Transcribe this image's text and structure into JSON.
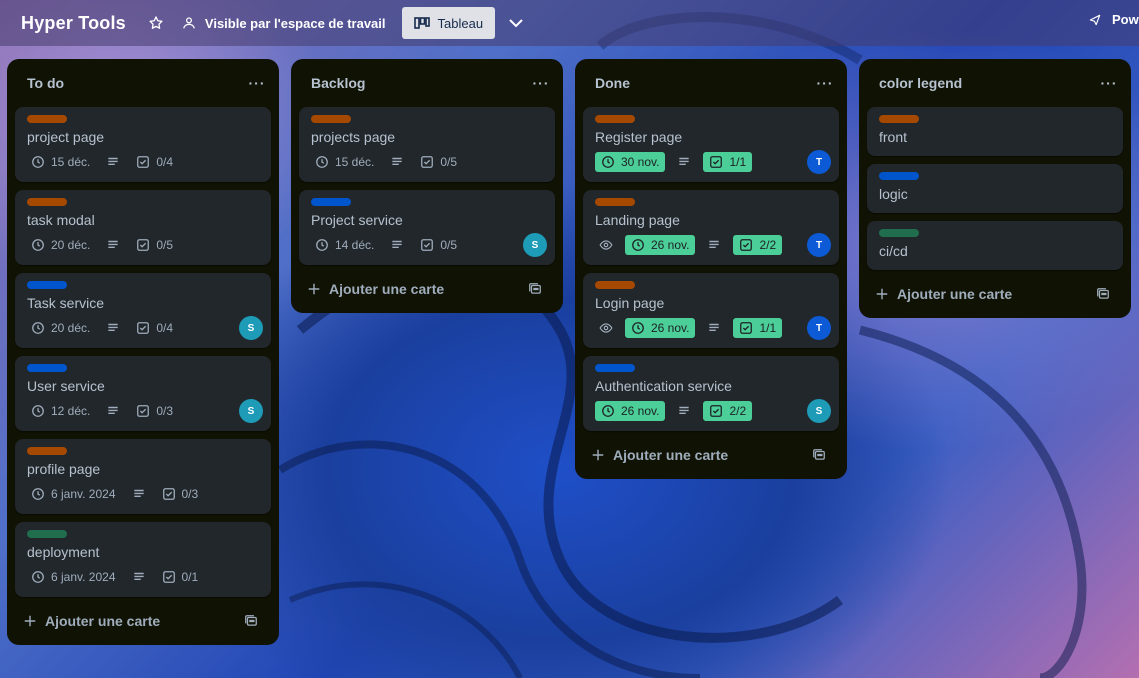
{
  "colors": {
    "orange": "#a54800",
    "blue": "#0055cc",
    "green": "#216e4e",
    "done_badge": "#4bce97",
    "avatar_T": "#0c5ad6",
    "avatar_S": "#1d9bb7"
  },
  "header": {
    "board_title": "Hyper Tools",
    "star_icon": "star-icon",
    "visibility_label": "Visible par l'espace de travail",
    "view_label": "Tableau",
    "powerups_label": "Pow"
  },
  "lists": [
    {
      "title": "To do",
      "add_label": "Ajouter une carte",
      "cards": [
        {
          "label": "orange",
          "title": "project page",
          "date": "15 déc.",
          "checklist": "0/4"
        },
        {
          "label": "orange",
          "title": "task modal",
          "date": "20 déc.",
          "checklist": "0/5"
        },
        {
          "label": "blue",
          "title": "Task service",
          "date": "20 déc.",
          "checklist": "0/4",
          "member": "S"
        },
        {
          "label": "blue",
          "title": "User service",
          "date": "12 déc.",
          "checklist": "0/3",
          "member": "S"
        },
        {
          "label": "orange",
          "title": "profile page",
          "date": "6 janv. 2024",
          "checklist": "0/3"
        },
        {
          "label": "green",
          "title": "deployment",
          "date": "6 janv. 2024",
          "checklist": "0/1"
        }
      ]
    },
    {
      "title": "Backlog",
      "add_label": "Ajouter une carte",
      "cards": [
        {
          "label": "orange",
          "title": "projects page",
          "date": "15 déc.",
          "checklist": "0/5"
        },
        {
          "label": "blue",
          "title": "Project service",
          "date": "14 déc.",
          "checklist": "0/5",
          "member": "S"
        }
      ]
    },
    {
      "title": "Done",
      "add_label": "Ajouter une carte",
      "cards": [
        {
          "label": "orange",
          "title": "Register page",
          "date": "30 nov.",
          "checklist": "1/1",
          "member": "T",
          "done": true
        },
        {
          "label": "orange",
          "title": "Landing page",
          "date": "26 nov.",
          "checklist": "2/2",
          "member": "T",
          "done": true,
          "watch": true
        },
        {
          "label": "orange",
          "title": "Login page",
          "date": "26 nov.",
          "checklist": "1/1",
          "member": "T",
          "done": true,
          "watch": true
        },
        {
          "label": "blue",
          "title": "Authentication service",
          "date": "26 nov.",
          "checklist": "2/2",
          "member": "S",
          "done": true
        }
      ]
    },
    {
      "title": "color legend",
      "add_label": "Ajouter une carte",
      "cards": [
        {
          "label": "orange",
          "title": "front"
        },
        {
          "label": "blue",
          "title": "logic"
        },
        {
          "label": "green",
          "title": "ci/cd"
        }
      ]
    }
  ]
}
